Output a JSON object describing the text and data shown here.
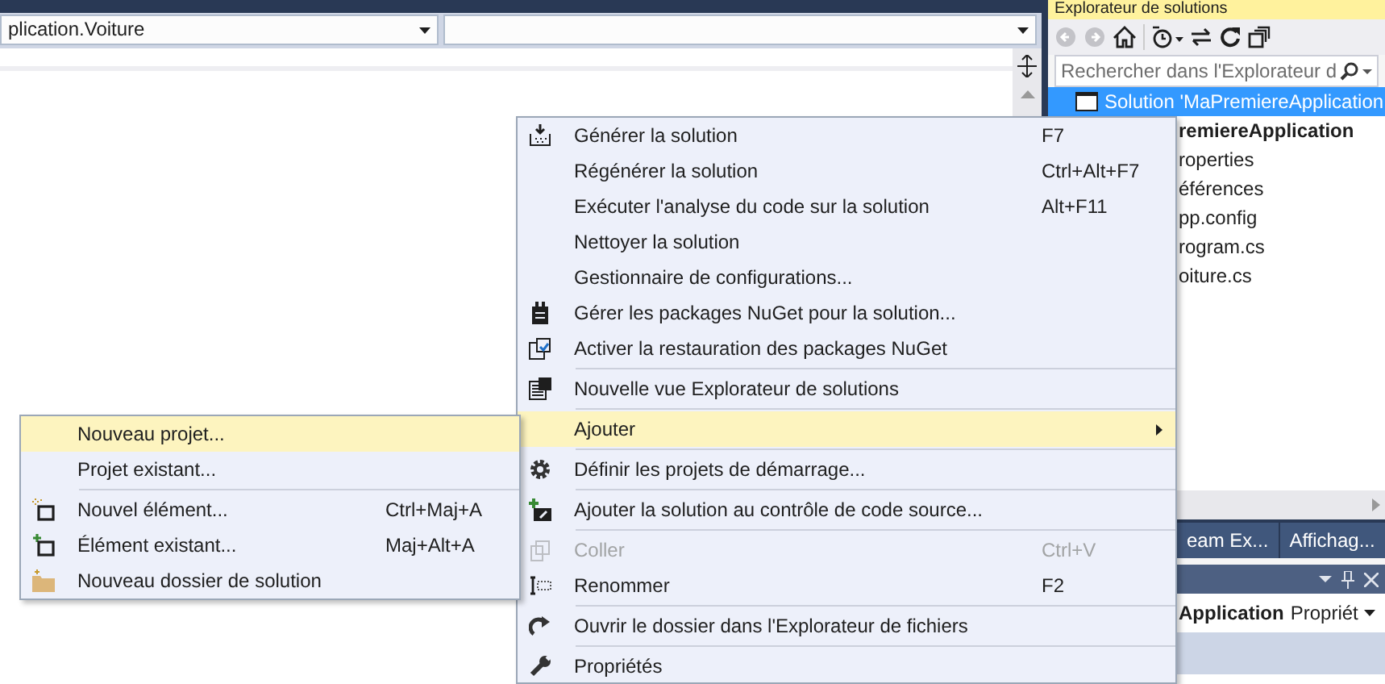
{
  "editor": {
    "type_combo": "plication.Voiture"
  },
  "solution_explorer": {
    "title": "Explorateur de solutions",
    "search": {
      "placeholder": "Rechercher dans l'Explorateur d"
    },
    "tree": [
      {
        "label": "Solution 'MaPremiereApplication",
        "selected": true,
        "bold": false,
        "children": [
          {
            "label": "remiereApplication",
            "selected": false,
            "bold": true,
            "children": [
              {
                "label": "roperties",
                "selected": false,
                "bold": false
              },
              {
                "label": "éférences",
                "selected": false,
                "bold": false
              },
              {
                "label": "pp.config",
                "selected": false,
                "bold": false
              },
              {
                "label": "rogram.cs",
                "selected": false,
                "bold": false
              },
              {
                "label": "oiture.cs",
                "selected": false,
                "bold": false
              }
            ]
          }
        ]
      }
    ]
  },
  "bottom_tabs": [
    {
      "label": "eam Ex..."
    },
    {
      "label": "Affichag..."
    }
  ],
  "properties": {
    "object": "Application",
    "type": "Propriét"
  },
  "context_menu": {
    "items": [
      {
        "kind": "item",
        "label": "Générer la solution",
        "shortcut": "F7",
        "selected": false,
        "disabled": false
      },
      {
        "kind": "item",
        "label": "Régénérer la solution",
        "shortcut": "Ctrl+Alt+F7",
        "selected": false,
        "disabled": false
      },
      {
        "kind": "item",
        "label": "Exécuter l'analyse du code sur la solution",
        "shortcut": "Alt+F11",
        "selected": false,
        "disabled": false
      },
      {
        "kind": "item",
        "label": "Nettoyer la solution",
        "selected": false,
        "disabled": false
      },
      {
        "kind": "item",
        "label": "Gestionnaire de configurations...",
        "selected": false,
        "disabled": false
      },
      {
        "kind": "item",
        "label": "Gérer les packages NuGet pour la solution...",
        "selected": false,
        "disabled": false
      },
      {
        "kind": "item",
        "label": "Activer la restauration des packages NuGet",
        "selected": false,
        "disabled": false
      },
      {
        "kind": "separator"
      },
      {
        "kind": "item",
        "label": "Nouvelle vue Explorateur de solutions",
        "selected": false,
        "disabled": false
      },
      {
        "kind": "separator"
      },
      {
        "kind": "item",
        "label": "Ajouter",
        "selected": true,
        "disabled": false,
        "has_submenu": true
      },
      {
        "kind": "separator"
      },
      {
        "kind": "item",
        "label": "Définir les projets de démarrage...",
        "selected": false,
        "disabled": false
      },
      {
        "kind": "separator"
      },
      {
        "kind": "item",
        "label": "Ajouter la solution au contrôle de code source...",
        "selected": false,
        "disabled": false
      },
      {
        "kind": "separator"
      },
      {
        "kind": "item",
        "label": "Coller",
        "shortcut": "Ctrl+V",
        "selected": false,
        "disabled": true
      },
      {
        "kind": "item",
        "label": "Renommer",
        "shortcut": "F2",
        "selected": false,
        "disabled": false
      },
      {
        "kind": "separator"
      },
      {
        "kind": "item",
        "label": "Ouvrir le dossier dans l'Explorateur de fichiers",
        "selected": false,
        "disabled": false
      },
      {
        "kind": "separator"
      },
      {
        "kind": "item",
        "label": "Propriétés",
        "selected": false,
        "disabled": false
      }
    ]
  },
  "submenu": {
    "items": [
      {
        "kind": "item",
        "label": "Nouveau projet...",
        "selected": true,
        "disabled": false
      },
      {
        "kind": "item",
        "label": "Projet existant...",
        "selected": false,
        "disabled": false
      },
      {
        "kind": "separator"
      },
      {
        "kind": "item",
        "label": "Nouvel élément...",
        "shortcut": "Ctrl+Maj+A",
        "selected": false,
        "disabled": false
      },
      {
        "kind": "item",
        "label": "Élément existant...",
        "shortcut": "Maj+Alt+A",
        "selected": false,
        "disabled": false
      },
      {
        "kind": "item",
        "label": "Nouveau dossier de solution",
        "selected": false,
        "disabled": false
      }
    ]
  }
}
